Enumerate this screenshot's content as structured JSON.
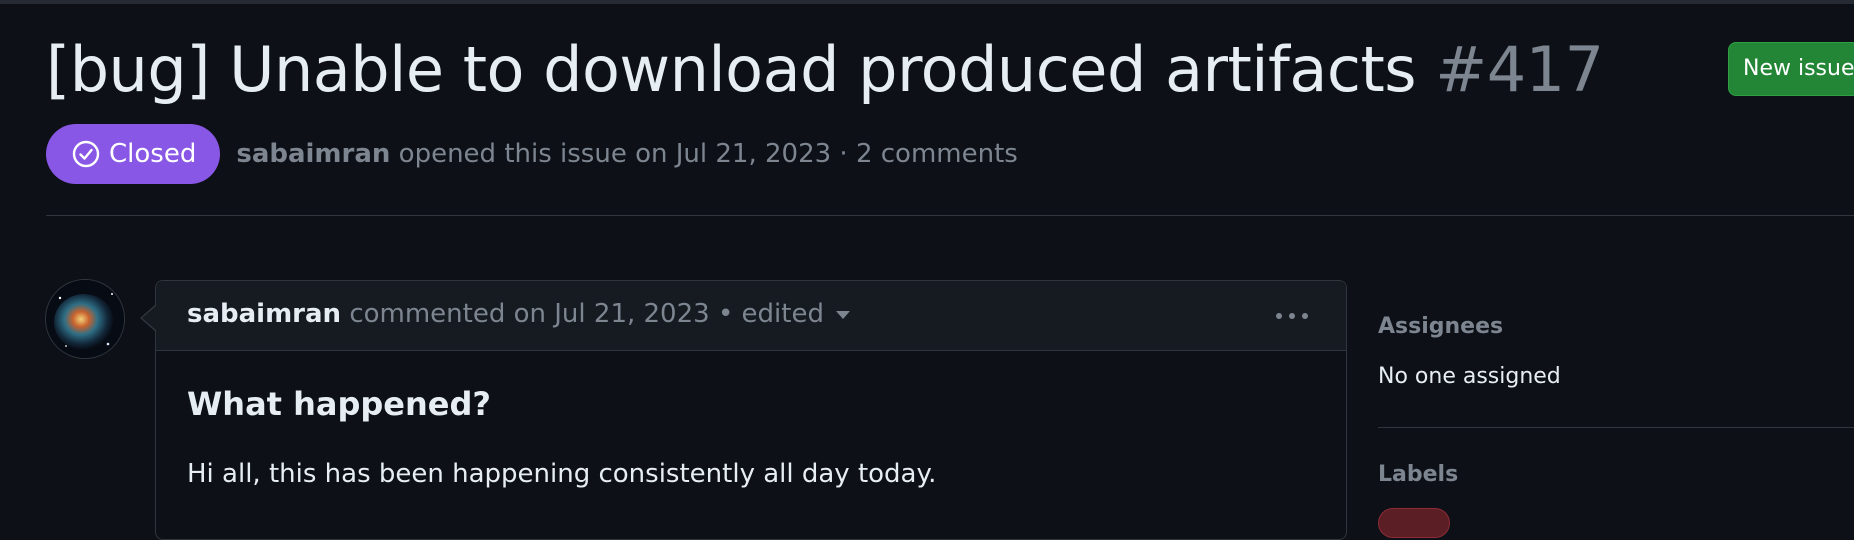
{
  "issue": {
    "title": "[bug] Unable to download produced artifacts",
    "number": "#417",
    "state": "Closed",
    "state_color": "#8957e5",
    "state_icon": "check-circle-icon",
    "author": "sabaimran",
    "opened_text": "opened this issue on Jul 21, 2023 · 2 comments"
  },
  "header_actions": {
    "new_issue_label": "New issue",
    "new_issue_color": "#238636"
  },
  "comment": {
    "author": "sabaimran",
    "meta_text": "commented on Jul 21, 2023 • edited",
    "edited_icon": "triangle-down-icon",
    "menu_icon": "kebab-horizontal-icon",
    "avatar_icon": "nebula-avatar",
    "body_heading": "What happened?",
    "body_text": "Hi all, this has been happening consistently all day today."
  },
  "sidebar": {
    "assignees_heading": "Assignees",
    "assignees_value": "No one assigned",
    "labels_heading": "Labels",
    "label_color": "#8e2b36"
  }
}
